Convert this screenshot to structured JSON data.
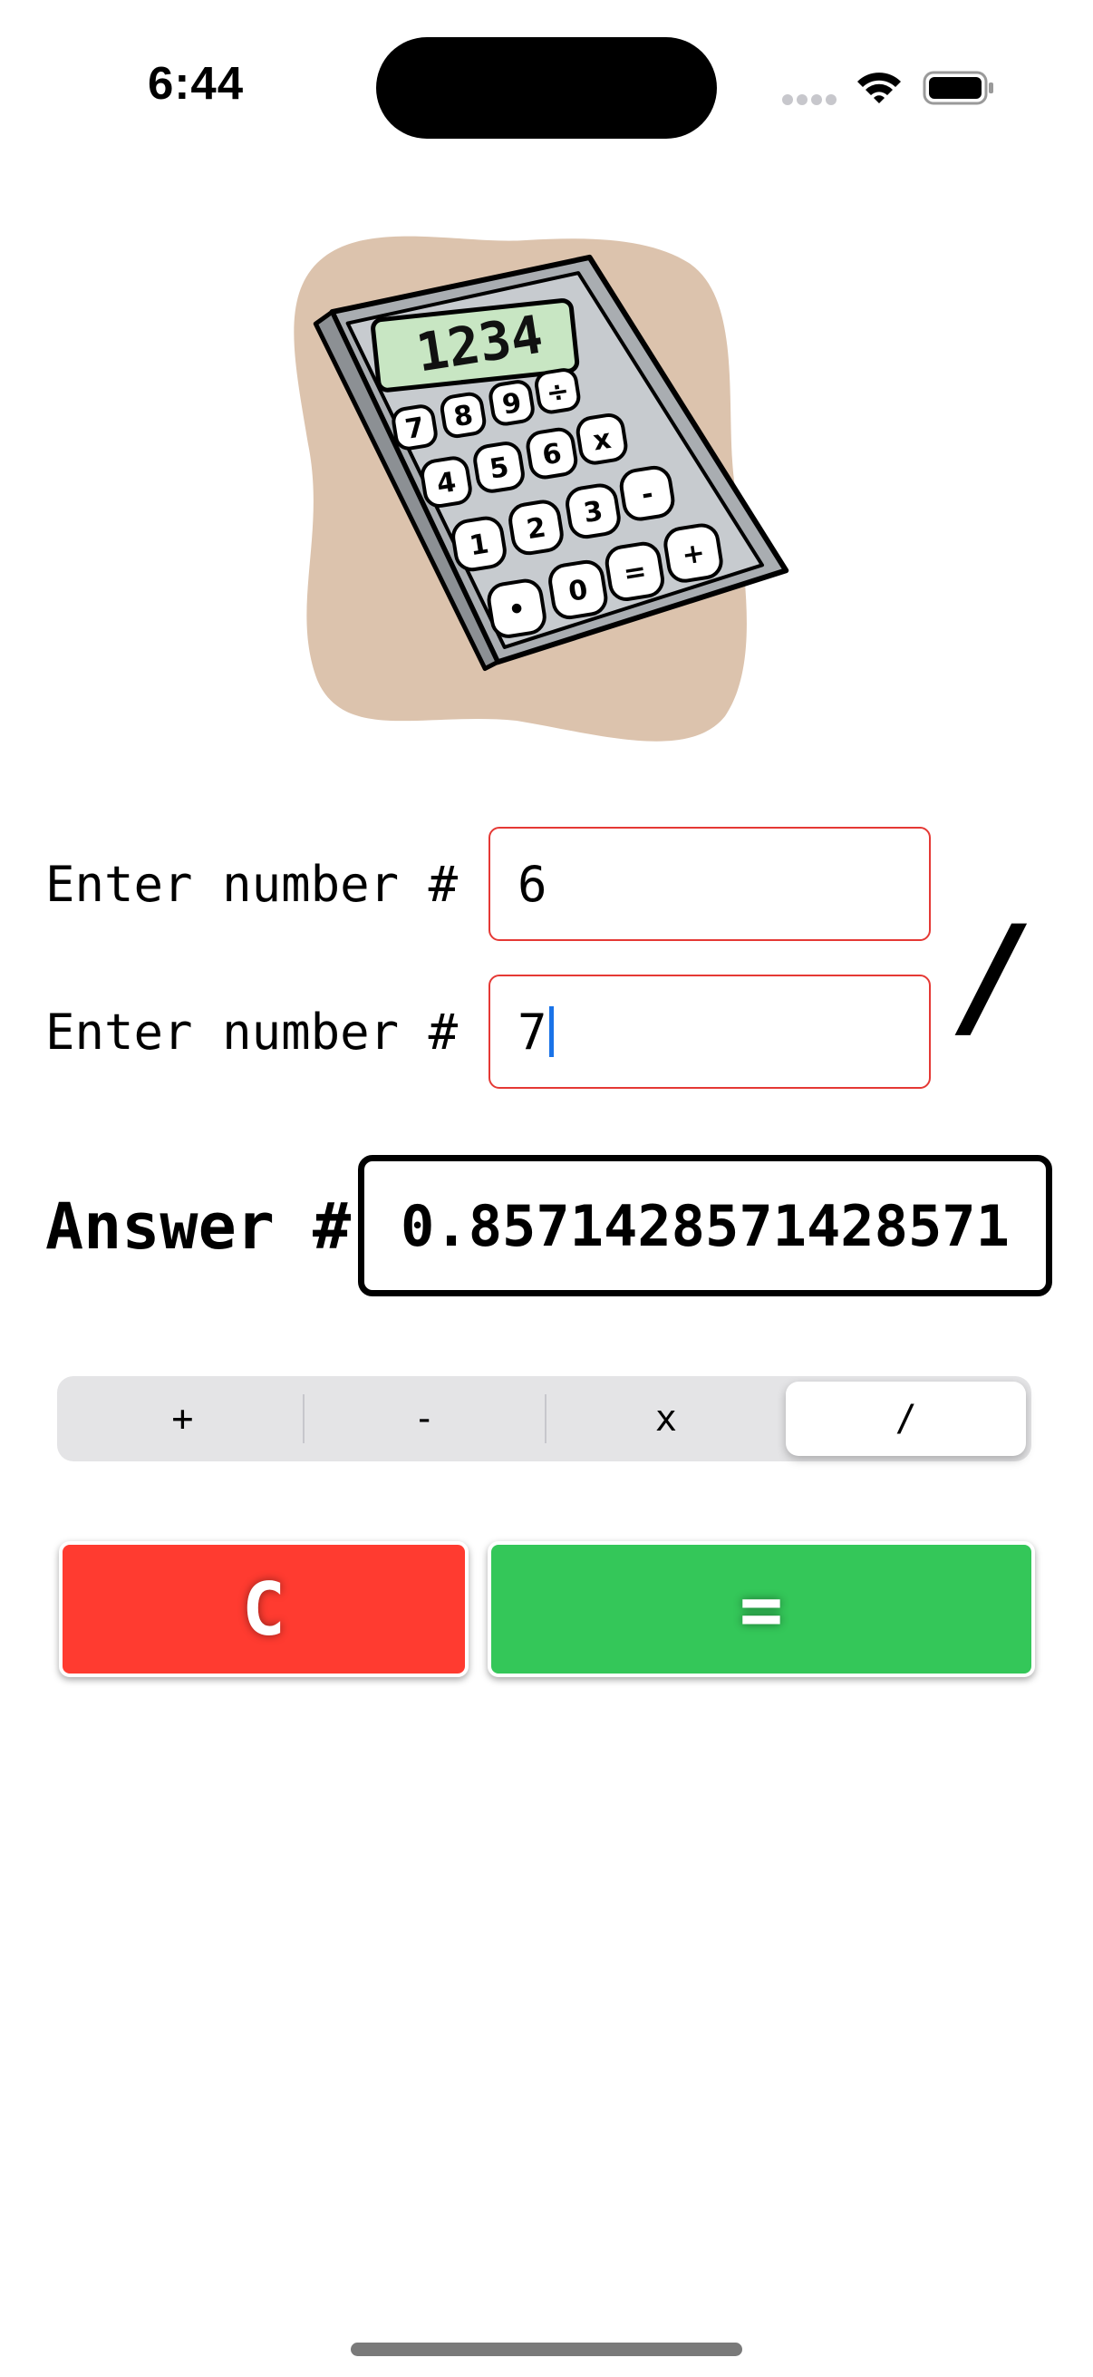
{
  "status_bar": {
    "time": "6:44"
  },
  "inputs": [
    {
      "label": "Enter number #",
      "value": "6"
    },
    {
      "label": "Enter number #",
      "value": "7"
    }
  ],
  "operator_symbol": "/",
  "answer": {
    "label": "Answer #",
    "value": "0.8571428571428571"
  },
  "operations": {
    "options": [
      "+",
      "-",
      "x",
      "/"
    ],
    "selected": "/"
  },
  "buttons": {
    "clear": "C",
    "equals": "="
  },
  "illustration": {
    "display_text": "1234"
  },
  "colors": {
    "input_border": "#e53935",
    "clear_button": "#ff3b30",
    "equals_button": "#34c759",
    "caret": "#1a73e8",
    "illustration_blob": "#dcc3ad",
    "illustration_screen": "#c8e6c3"
  },
  "icons": [
    "signal-icon",
    "wifi-icon",
    "battery-icon",
    "calculator-illustration"
  ]
}
